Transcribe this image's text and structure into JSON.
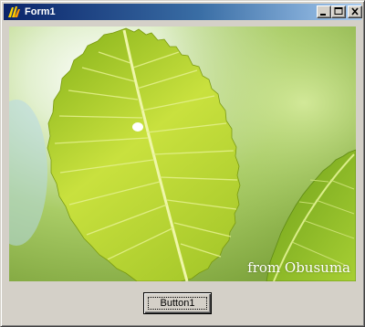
{
  "window": {
    "title": "Form1",
    "title_bar_gradient": [
      "#0a246a",
      "#a6caf0"
    ],
    "face_color": "#d4d0c8",
    "controls": {
      "minimize_icon": "minimize-icon",
      "maximize_icon": "maximize-icon",
      "close_icon": "close-icon"
    }
  },
  "image": {
    "subject": "leaf-photo",
    "watermark": "from Obusuma",
    "colors": {
      "leaf": "#b8d43a",
      "leaf_vein": "#e4f089",
      "background": "#c3dc88"
    }
  },
  "button1": {
    "label": "Button1"
  }
}
